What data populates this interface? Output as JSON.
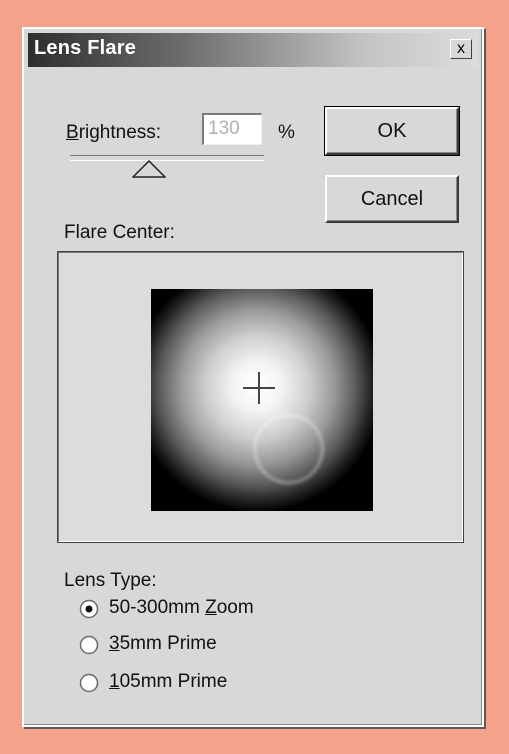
{
  "window": {
    "title": "Lens Flare",
    "close_label": "x"
  },
  "brightness": {
    "label_underlined": "B",
    "label_rest": "rightness:",
    "value": "130",
    "unit": "%",
    "slider_level_percent": 130
  },
  "buttons": {
    "ok_label": "OK",
    "cancel_label": "Cancel"
  },
  "flare_center": {
    "label": "Flare Center:"
  },
  "lens_type": {
    "label": "Lens Type:",
    "options": [
      {
        "pre": "50-300mm ",
        "u": "Z",
        "post": "oom",
        "selected": true
      },
      {
        "pre": "",
        "u": "3",
        "post": "5mm Prime",
        "selected": false
      },
      {
        "pre": "",
        "u": "1",
        "post": "05mm Prime",
        "selected": false
      }
    ]
  },
  "icons": [
    "close-icon",
    "slider-thumb-icon",
    "crosshair-icon",
    "radio-icon"
  ],
  "colors": {
    "background": "#f4a38a",
    "dialog": "#d8d8d8",
    "title_dark": "#2e2e2e"
  }
}
